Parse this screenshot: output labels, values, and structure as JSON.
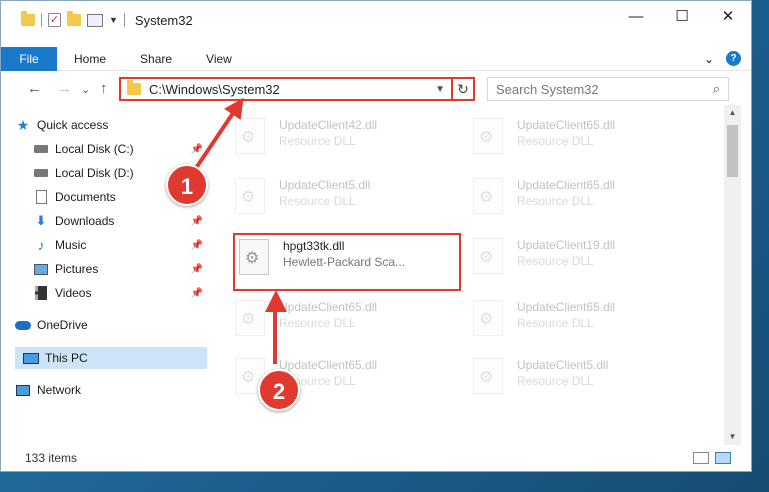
{
  "window": {
    "title": "System32",
    "controls": {
      "minimize": "—",
      "maximize": "☐",
      "close": "✕"
    }
  },
  "ribbon": {
    "file_tab": "File",
    "tabs": [
      "Home",
      "Share",
      "View"
    ],
    "expand": "⌄",
    "help": "?"
  },
  "nav": {
    "back": "←",
    "forward": "→",
    "recent": "⌄",
    "up": "↑",
    "address": "C:\\Windows\\System32",
    "refresh": "↻",
    "search_placeholder": "Search System32",
    "search_icon": "⌕"
  },
  "sidebar": {
    "items": [
      {
        "label": "Quick access",
        "icon": "star-icon"
      },
      {
        "label": "Local Disk (C:)",
        "icon": "drive-icon",
        "pin": "📌"
      },
      {
        "label": "Local Disk (D:)",
        "icon": "drive-icon"
      },
      {
        "label": "Documents",
        "icon": "documents-icon",
        "pin": "📌"
      },
      {
        "label": "Downloads",
        "icon": "downloads-icon",
        "pin": "📌"
      },
      {
        "label": "Music",
        "icon": "music-icon",
        "pin": "📌"
      },
      {
        "label": "Pictures",
        "icon": "pictures-icon",
        "pin": "📌"
      },
      {
        "label": "Videos",
        "icon": "videos-icon",
        "pin": "📌"
      },
      {
        "label": "OneDrive",
        "icon": "onedrive-icon"
      },
      {
        "label": "This PC",
        "icon": "pc-icon",
        "selected": true
      },
      {
        "label": "Network",
        "icon": "network-icon"
      }
    ]
  },
  "files": [
    {
      "name": "UpdateClient42.dll",
      "desc": "Resource DLL"
    },
    {
      "name": "UpdateClient65.dll",
      "desc": "Resource DLL"
    },
    {
      "name": "UpdateClient5.dll",
      "desc": "Resource DLL"
    },
    {
      "name": "UpdateClient65.dll",
      "desc": "Resource DLL"
    },
    {
      "name": "hpgt33tk.dll",
      "desc": "Hewlett-Packard Sca...",
      "highlighted": true
    },
    {
      "name": "UpdateClient19.dll",
      "desc": "Resource DLL"
    },
    {
      "name": "UpdateClient65.dll",
      "desc": "Resource DLL"
    },
    {
      "name": "UpdateClient65.dll",
      "desc": "Resource DLL"
    },
    {
      "name": "UpdateClient65.dll",
      "desc": "Resource DLL"
    },
    {
      "name": "UpdateClient5.dll",
      "desc": "Resource DLL"
    }
  ],
  "status": {
    "item_count": "133 items"
  },
  "callouts": [
    "1",
    "2"
  ],
  "colors": {
    "accent": "#1979ca",
    "highlight": "#e0392f",
    "selected": "#cce4f7"
  }
}
